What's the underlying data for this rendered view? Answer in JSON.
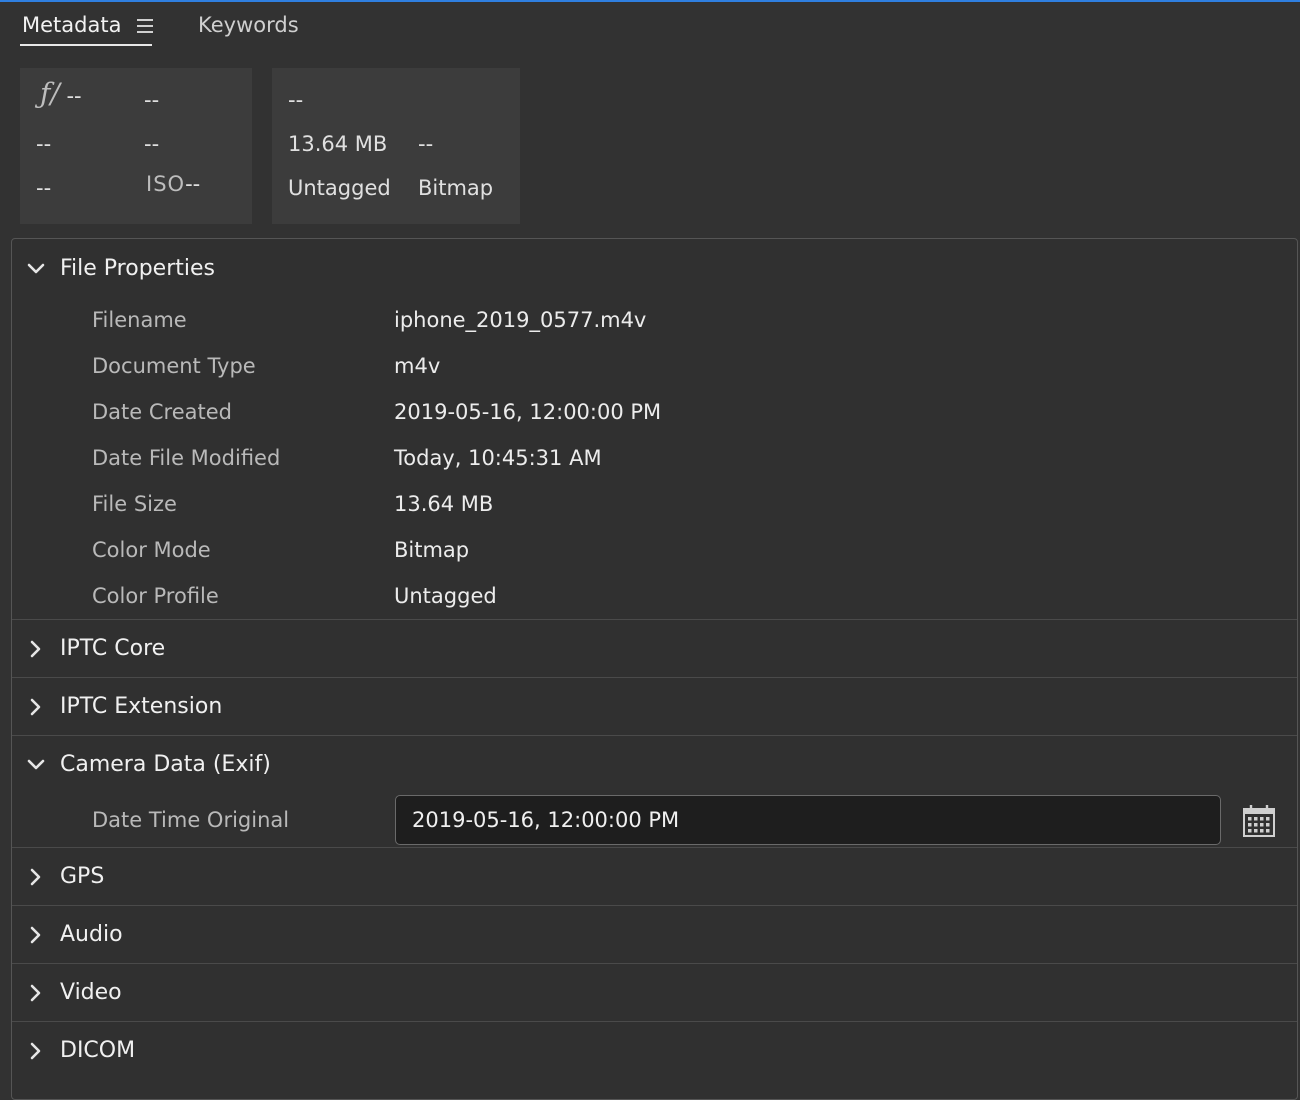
{
  "tabs": {
    "metadata_label": "Metadata",
    "keywords_label": "Keywords"
  },
  "info_box_1": {
    "fstop_symbol": "ƒ/",
    "fstop_value": "--",
    "exposure": "--",
    "r2c1": "--",
    "r2c2": "--",
    "r3c1": "--",
    "iso_symbol": "ISO",
    "iso_value": "--"
  },
  "info_box_2": {
    "r1c1": "--",
    "file_size": "13.64 MB",
    "r2c2": "--",
    "color_profile": "Untagged",
    "color_mode": "Bitmap"
  },
  "sections": {
    "file_properties": {
      "title": "File Properties",
      "expanded": true,
      "rows": [
        {
          "label": "Filename",
          "value": "iphone_2019_0577.m4v"
        },
        {
          "label": "Document Type",
          "value": "m4v"
        },
        {
          "label": "Date Created",
          "value": "2019-05-16, 12:00:00 PM"
        },
        {
          "label": "Date File Modified",
          "value": "Today, 10:45:31 AM"
        },
        {
          "label": "File Size",
          "value": "13.64 MB"
        },
        {
          "label": "Color Mode",
          "value": "Bitmap"
        },
        {
          "label": "Color Profile",
          "value": "Untagged"
        }
      ]
    },
    "iptc_core": {
      "title": "IPTC Core",
      "expanded": false
    },
    "iptc_extension": {
      "title": "IPTC Extension",
      "expanded": false
    },
    "camera_data": {
      "title": "Camera Data (Exif)",
      "expanded": true,
      "date_time_original_label": "Date Time Original",
      "date_time_original_value": "2019-05-16, 12:00:00 PM"
    },
    "gps": {
      "title": "GPS",
      "expanded": false
    },
    "audio": {
      "title": "Audio",
      "expanded": false
    },
    "video": {
      "title": "Video",
      "expanded": false
    },
    "dicom": {
      "title": "DICOM",
      "expanded": false
    }
  },
  "colors": {
    "accent": "#2f7fe0",
    "panel_bg": "#323232",
    "box_bg": "#3c3c3c",
    "input_bg": "#1e1e1e"
  },
  "icons": {
    "menu": "hamburger-menu-icon",
    "expanded": "chevron-down-icon",
    "collapsed": "chevron-right-icon",
    "calendar": "calendar-icon"
  }
}
